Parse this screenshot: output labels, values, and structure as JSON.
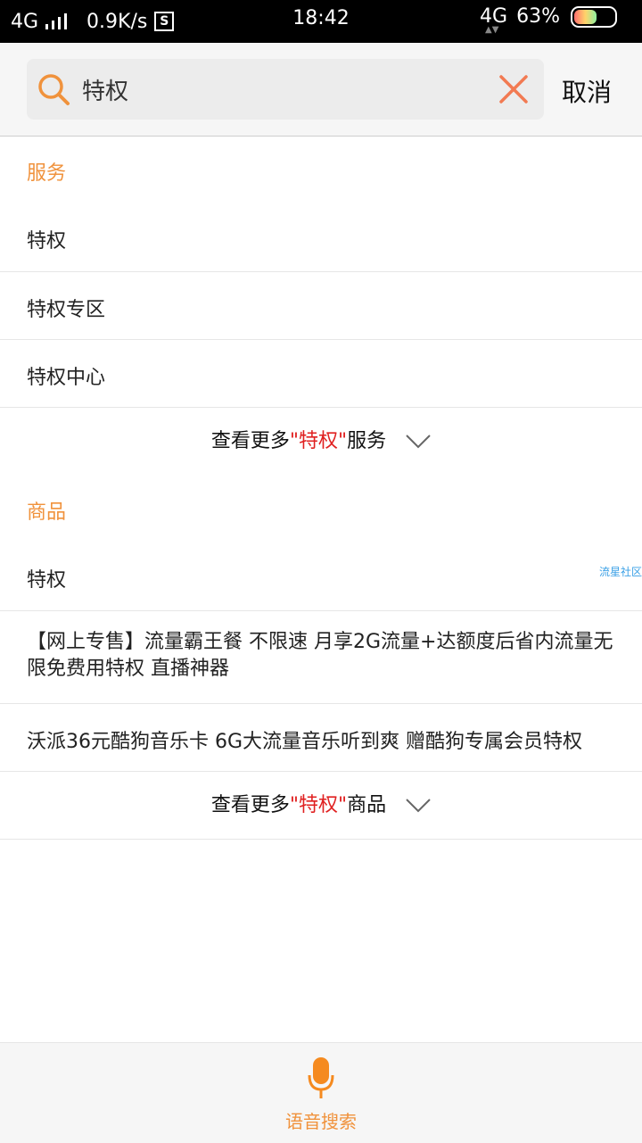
{
  "status_bar": {
    "network": "4G",
    "speed": "0.9K/s",
    "s_badge": "S",
    "time": "18:42",
    "network_right": "4G",
    "battery": "63%",
    "battery_level": 0.63
  },
  "search": {
    "query": "特权",
    "placeholder": "",
    "cancel_label": "取消"
  },
  "services": {
    "title": "服务",
    "items": [
      "特权",
      "特权专区",
      "特权中心"
    ],
    "more_prefix": "查看更多",
    "more_keyword": "\"特权\"",
    "more_suffix": "服务"
  },
  "products": {
    "title": "商品",
    "items": [
      "特权",
      "【网上专售】流量霸王餐 不限速 月享2G流量+达额度后省内流量无限免费用特权 直播神器",
      "沃派36元酷狗音乐卡 6G大流量音乐听到爽 赠酷狗专属会员特权"
    ],
    "side_tag": "流星社区",
    "more_prefix": "查看更多",
    "more_keyword": "\"特权\"",
    "more_suffix": "商品"
  },
  "bottom": {
    "voice_label": "语音搜索"
  },
  "colors": {
    "accent": "#f0923c",
    "keyword": "#e02020",
    "status_bg": "#000000"
  },
  "icons": {
    "search": "search-icon",
    "clear": "close-icon",
    "chevron": "chevron-down-icon",
    "mic": "mic-icon"
  }
}
